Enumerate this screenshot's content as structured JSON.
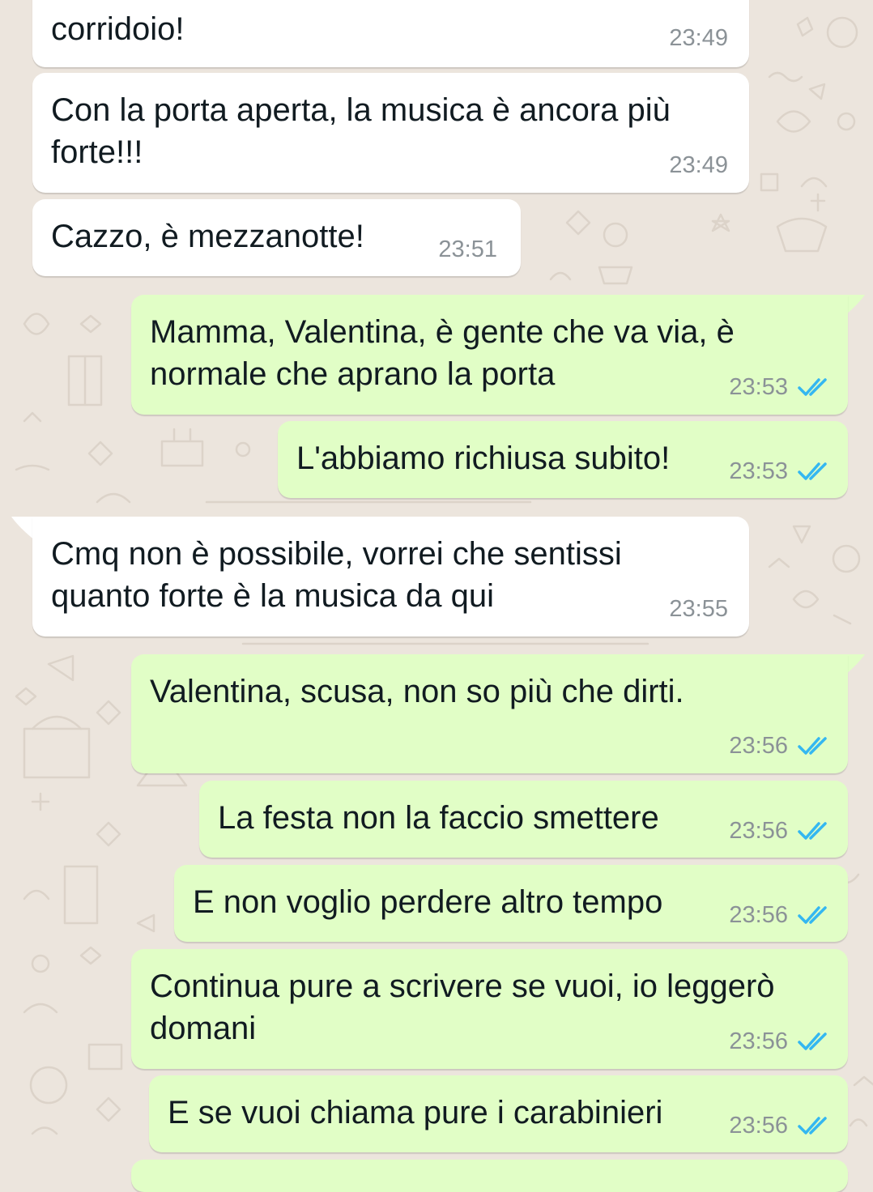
{
  "colors": {
    "background": "#ece5dd",
    "incoming_bubble": "#ffffff",
    "outgoing_bubble": "#e1fec6",
    "timestamp": "#8b9297",
    "read_ticks": "#34b7f1"
  },
  "messages": [
    {
      "direction": "incoming",
      "text": "corridoio!",
      "time": "23:49",
      "status": ""
    },
    {
      "direction": "incoming",
      "text": "Con la porta aperta, la musica è ancora più\nforte!!!",
      "time": "23:49",
      "status": ""
    },
    {
      "direction": "incoming",
      "text": "Cazzo, è mezzanotte!",
      "time": "23:51",
      "status": ""
    },
    {
      "direction": "outgoing",
      "text": "Mamma, Valentina, è gente che va via, è\nnormale che aprano la porta",
      "time": "23:53",
      "status": "read",
      "icon": "double-check-icon"
    },
    {
      "direction": "outgoing",
      "text": "L'abbiamo richiusa subito!",
      "time": "23:53",
      "status": "read",
      "icon": "double-check-icon"
    },
    {
      "direction": "incoming",
      "text": "Cmq non è possibile, vorrei che sentissi\nquanto forte è la musica da qui",
      "time": "23:55",
      "status": ""
    },
    {
      "direction": "outgoing",
      "text": "Valentina, scusa, non so più che dirti.",
      "time": "23:56",
      "status": "read",
      "icon": "double-check-icon"
    },
    {
      "direction": "outgoing",
      "text": "La festa non la faccio smettere",
      "time": "23:56",
      "status": "read",
      "icon": "double-check-icon"
    },
    {
      "direction": "outgoing",
      "text": "E non voglio perdere altro tempo",
      "time": "23:56",
      "status": "read",
      "icon": "double-check-icon"
    },
    {
      "direction": "outgoing",
      "text": "Continua pure a scrivere se vuoi, io leggerò\ndomani",
      "time": "23:56",
      "status": "read",
      "icon": "double-check-icon"
    },
    {
      "direction": "outgoing",
      "text": "E se vuoi chiama pure i carabinieri",
      "time": "23:56",
      "status": "read",
      "icon": "double-check-icon"
    }
  ]
}
